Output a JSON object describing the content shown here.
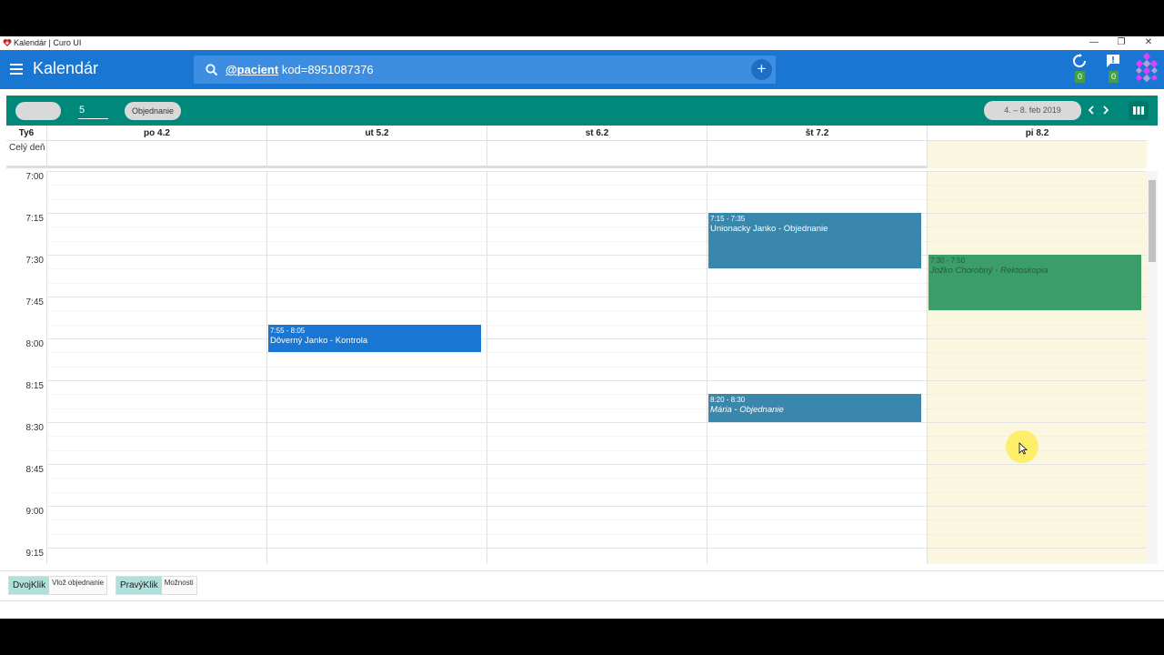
{
  "window": {
    "title": "Kalendár | Curo UI",
    "controls": {
      "minimize": "—",
      "restore": "❐",
      "close": "✕"
    }
  },
  "appbar": {
    "title": "Kalendár",
    "search": {
      "token": "@pacient",
      "query": " kod=8951087376",
      "add_label": "+"
    },
    "sync_count": "0",
    "notifications_count": "0"
  },
  "toolbar": {
    "day_count": "5",
    "appointment_label": "Objednanie",
    "date_range": "4. – 8. feb 2019"
  },
  "calendar": {
    "week_label": "Ty6",
    "allday_label": "Celý deň",
    "days": [
      "po 4.2",
      "ut 5.2",
      "st 6.2",
      "št 7.2",
      "pi 8.2"
    ],
    "times": [
      "7:00",
      "7:15",
      "7:30",
      "7:45",
      "8:00",
      "8:15",
      "8:30",
      "8:45",
      "9:00",
      "9:15"
    ],
    "events": [
      {
        "time": "7:15 - 7:35",
        "title": "Unionacky Janko - Objednanie",
        "color": "#3a87ad"
      },
      {
        "time": "7:55 - 8:05",
        "title": "Dôverný Janko - Kontrola",
        "color": "#1976d2"
      },
      {
        "time": "7:30 - 7:50",
        "title": "Jožko Chorobný - Rektoskopia",
        "color": "#3a9d6a"
      },
      {
        "time": "8:20 - 8:30",
        "title": "Mária - Objednanie",
        "color": "#3a87ad"
      }
    ]
  },
  "footer": {
    "hints": [
      {
        "key": "DvojKlik",
        "desc": "Vlož objednanie"
      },
      {
        "key": "PravýKlik",
        "desc": "Možnosti"
      }
    ]
  },
  "colors": {
    "appbar": "#1976d2",
    "toolbar": "#00897b",
    "today": "#fbf6df",
    "badge": "#43a047"
  }
}
